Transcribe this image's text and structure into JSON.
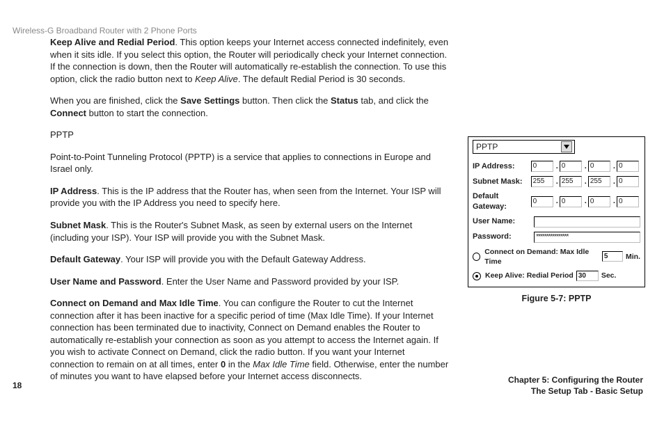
{
  "header": "Wireless-G Broadband Router with 2 Phone Ports",
  "page_number": "18",
  "footer": {
    "chapter": "Chapter 5: Configuring the Router",
    "section": "The Setup Tab - Basic Setup"
  },
  "body": {
    "p1_strong": "Keep Alive and Redial Period",
    "p1_a": ". This option keeps your Internet access connected indefinitely, even when it sits idle. If you select this option, the Router will periodically check your Internet connection. If the connection is down, then the Router will automatically re-establish the connection. To use this option, click the radio button next to ",
    "p1_i": "Keep Alive",
    "p1_b": ". The default Redial Period is 30 seconds.",
    "p2_a": "When you are finished, click the ",
    "p2_s1": "Save Settings",
    "p2_b": " button. Then click the ",
    "p2_s2": "Status",
    "p2_c": " tab, and click the ",
    "p2_s3": "Connect",
    "p2_d": " button to start the connection.",
    "heading": "PPTP",
    "p3": "Point-to-Point Tunneling Protocol (PPTP) is a service that applies to connections in Europe and Israel only.",
    "p4_s": "IP Address",
    "p4_a": ". This is the IP address that the Router has, when seen from the Internet. Your ISP will provide you with the IP Address you need to specify here.",
    "p5_s": "Subnet Mask",
    "p5_a": ". This is the Router's Subnet Mask, as seen by external users on the Internet (including your ISP). Your ISP will provide you with the Subnet Mask.",
    "p6_s": "Default Gateway",
    "p6_a": ". Your ISP will provide you with the Default Gateway Address.",
    "p7_s": "User Name and Password",
    "p7_a": ". Enter the User Name and Password provided by your ISP.",
    "p8_s": "Connect on Demand and Max Idle Time",
    "p8_a": ". You can configure the Router to cut the Internet connection after it has been inactive for a specific period of time (Max Idle Time). If your Internet connection has been terminated due to inactivity, Connect on Demand enables the Router to automatically re-establish your connection as soon as you attempt to access the Internet again. If you wish to activate Connect on Demand, click the radio button. If you want your Internet connection to remain on at all times, enter ",
    "p8_s2": "0",
    "p8_b": " in the ",
    "p8_i": "Max Idle Time",
    "p8_c": " field. Otherwise, enter the number of minutes you want to have elapsed before your Internet access disconnects."
  },
  "figure": {
    "caption": "Figure 5-7: PPTP",
    "select_label": "PPTP",
    "labels": {
      "ip": "IP Address:",
      "mask": "Subnet Mask:",
      "gw": "Default Gateway:",
      "user": "User Name:",
      "pass": "Password:"
    },
    "ip": [
      "0",
      "0",
      "0",
      "0"
    ],
    "mask": [
      "255",
      "255",
      "255",
      "0"
    ],
    "gw": [
      "0",
      "0",
      "0",
      "0"
    ],
    "user_value": "",
    "pass_value": "****************",
    "cod_label": "Connect on Demand: Max Idle Time",
    "cod_value": "5",
    "cod_unit": "Min.",
    "ka_label": "Keep Alive: Redial Period",
    "ka_value": "30",
    "ka_unit": "Sec."
  }
}
